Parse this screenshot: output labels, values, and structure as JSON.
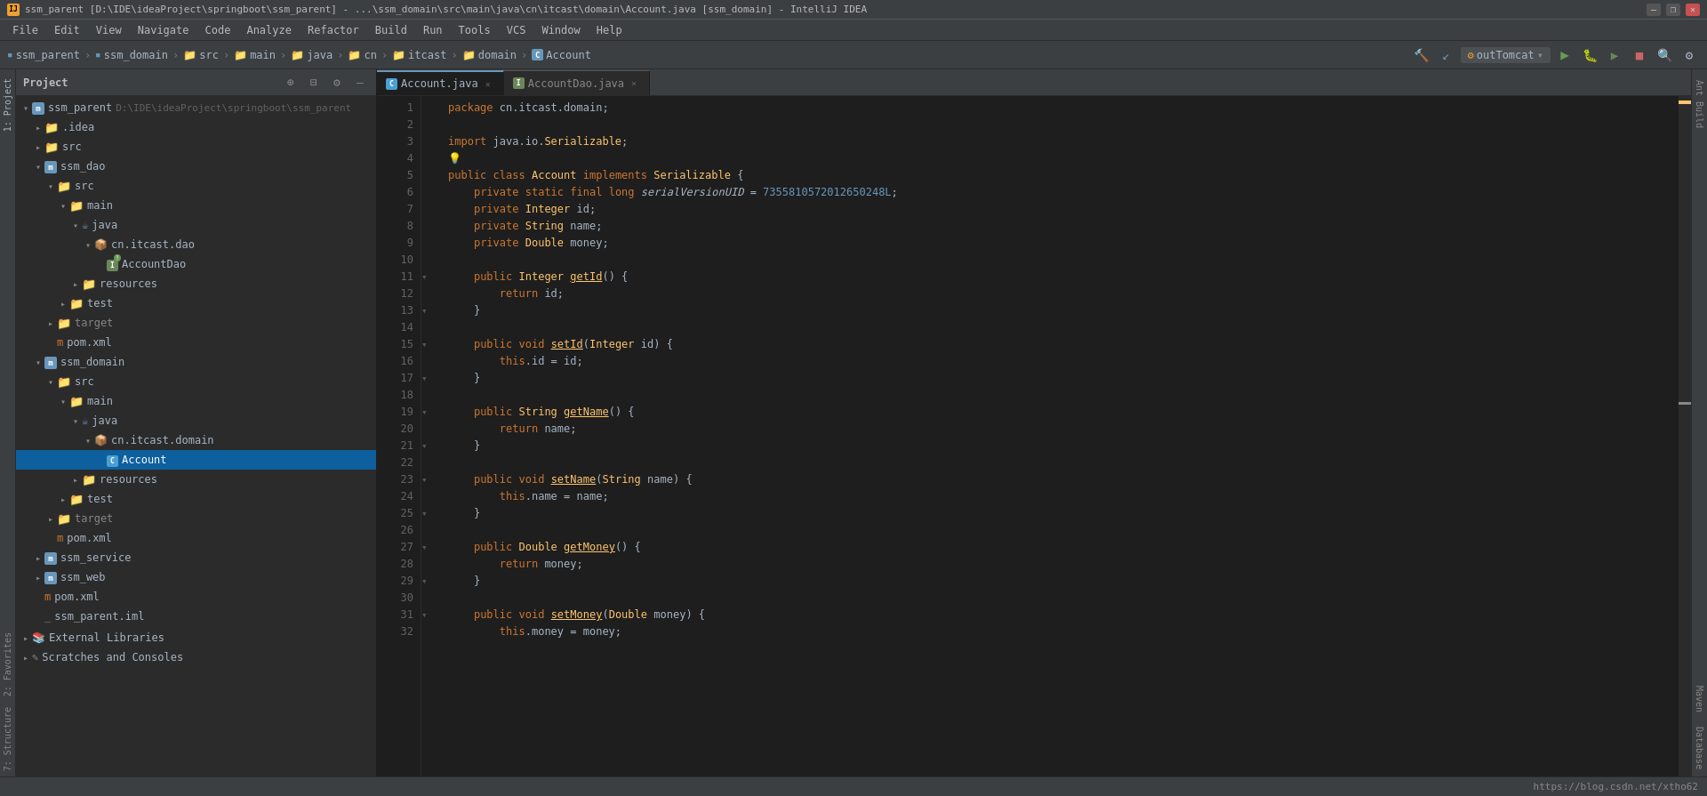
{
  "title_bar": {
    "icon": "IJ",
    "text": "ssm_parent [D:\\IDE\\ideaProject\\springboot\\ssm_parent] - ...\\ssm_domain\\src\\main\\java\\cn\\itcast\\domain\\Account.java [ssm_domain] - IntelliJ IDEA",
    "minimize": "—",
    "maximize": "❒",
    "close": "✕"
  },
  "menu": {
    "items": [
      "File",
      "Edit",
      "View",
      "Navigate",
      "Code",
      "Analyze",
      "Refactor",
      "Build",
      "Run",
      "Tools",
      "VCS",
      "Window",
      "Help"
    ]
  },
  "breadcrumb": {
    "items": [
      "ssm_parent",
      "ssm_domain",
      "src",
      "main",
      "java",
      "cn",
      "itcast",
      "domain",
      "Account"
    ],
    "run_config": "outTomcat"
  },
  "project_panel": {
    "title": "Project",
    "tree": [
      {
        "id": "ssm_parent",
        "indent": 0,
        "type": "module",
        "label": "ssm_parent",
        "path": "D:\\IDE\\ideaProject\\springboot\\ssm_parent",
        "arrow": "expanded"
      },
      {
        "id": "idea",
        "indent": 1,
        "type": "folder",
        "label": ".idea",
        "arrow": "collapsed"
      },
      {
        "id": "src_top",
        "indent": 1,
        "type": "folder",
        "label": "src",
        "arrow": "collapsed"
      },
      {
        "id": "ssm_dao",
        "indent": 1,
        "type": "module",
        "label": "ssm_dao",
        "arrow": "expanded"
      },
      {
        "id": "ssm_dao_src",
        "indent": 2,
        "type": "folder",
        "label": "src",
        "arrow": "expanded"
      },
      {
        "id": "ssm_dao_main",
        "indent": 3,
        "type": "folder",
        "label": "main",
        "arrow": "expanded"
      },
      {
        "id": "ssm_dao_java",
        "indent": 4,
        "type": "java",
        "label": "java",
        "arrow": "expanded"
      },
      {
        "id": "cn_itcast_dao",
        "indent": 5,
        "type": "package",
        "label": "cn.itcast.dao",
        "arrow": "expanded"
      },
      {
        "id": "AccountDao",
        "indent": 6,
        "type": "interface",
        "label": "AccountDao",
        "arrow": "empty"
      },
      {
        "id": "resources_dao",
        "indent": 4,
        "type": "folder",
        "label": "resources",
        "arrow": "collapsed"
      },
      {
        "id": "test_dao",
        "indent": 3,
        "type": "folder",
        "label": "test",
        "arrow": "collapsed"
      },
      {
        "id": "target_dao",
        "indent": 2,
        "type": "folder_target",
        "label": "target",
        "arrow": "collapsed"
      },
      {
        "id": "pom_dao",
        "indent": 2,
        "type": "xml",
        "label": "pom.xml",
        "arrow": "empty"
      },
      {
        "id": "ssm_domain",
        "indent": 1,
        "type": "module",
        "label": "ssm_domain",
        "arrow": "expanded"
      },
      {
        "id": "ssm_domain_src",
        "indent": 2,
        "type": "folder",
        "label": "src",
        "arrow": "expanded"
      },
      {
        "id": "ssm_domain_main",
        "indent": 3,
        "type": "folder",
        "label": "main",
        "arrow": "expanded"
      },
      {
        "id": "ssm_domain_java",
        "indent": 4,
        "type": "java",
        "label": "java",
        "arrow": "expanded"
      },
      {
        "id": "cn_itcast_domain",
        "indent": 5,
        "type": "package",
        "label": "cn.itcast.domain",
        "arrow": "expanded"
      },
      {
        "id": "Account",
        "indent": 6,
        "type": "class",
        "label": "Account",
        "arrow": "empty",
        "selected": true
      },
      {
        "id": "resources_domain",
        "indent": 4,
        "type": "folder",
        "label": "resources",
        "arrow": "collapsed"
      },
      {
        "id": "test_domain",
        "indent": 3,
        "type": "folder",
        "label": "test",
        "arrow": "collapsed"
      },
      {
        "id": "target_domain",
        "indent": 2,
        "type": "folder_target",
        "label": "target",
        "arrow": "collapsed"
      },
      {
        "id": "pom_domain",
        "indent": 2,
        "type": "xml",
        "label": "pom.xml",
        "arrow": "empty"
      },
      {
        "id": "ssm_service",
        "indent": 1,
        "type": "module",
        "label": "ssm_service",
        "arrow": "collapsed"
      },
      {
        "id": "ssm_web",
        "indent": 1,
        "type": "module",
        "label": "ssm_web",
        "arrow": "collapsed"
      },
      {
        "id": "pom_root",
        "indent": 1,
        "type": "xml",
        "label": "pom.xml",
        "arrow": "empty"
      },
      {
        "id": "ssm_parent_iml",
        "indent": 1,
        "type": "file",
        "label": "ssm_parent.iml",
        "arrow": "empty"
      },
      {
        "id": "external_libs",
        "indent": 0,
        "type": "libs",
        "label": "External Libraries",
        "arrow": "collapsed"
      },
      {
        "id": "scratches",
        "indent": 0,
        "type": "scratch",
        "label": "Scratches and Consoles",
        "arrow": "collapsed"
      }
    ]
  },
  "tabs": [
    {
      "id": "account_java",
      "label": "Account.java",
      "type": "class",
      "active": true
    },
    {
      "id": "account_dao_java",
      "label": "AccountDao.java",
      "type": "interface",
      "active": false
    }
  ],
  "code": {
    "lines": [
      {
        "num": 1,
        "content": "package cn.itcast.domain;",
        "tokens": [
          {
            "t": "kw",
            "v": "package"
          },
          {
            "t": "plain",
            "v": " cn.itcast.domain;"
          }
        ]
      },
      {
        "num": 2,
        "content": "",
        "tokens": []
      },
      {
        "num": 3,
        "content": "import java.io.Serializable;",
        "tokens": [
          {
            "t": "kw",
            "v": "import"
          },
          {
            "t": "plain",
            "v": " java.io.Serializable;"
          }
        ]
      },
      {
        "num": 4,
        "content": "💡",
        "tokens": [
          {
            "t": "bulb",
            "v": "💡"
          }
        ]
      },
      {
        "num": 5,
        "content": "public class Account implements Serializable {",
        "tokens": [
          {
            "t": "kw",
            "v": "public"
          },
          {
            "t": "plain",
            "v": " "
          },
          {
            "t": "kw",
            "v": "class"
          },
          {
            "t": "plain",
            "v": " "
          },
          {
            "t": "cls",
            "v": "Account"
          },
          {
            "t": "plain",
            "v": " "
          },
          {
            "t": "kw",
            "v": "implements"
          },
          {
            "t": "plain",
            "v": " "
          },
          {
            "t": "cls",
            "v": "Serializable"
          },
          {
            "t": "plain",
            "v": " {"
          }
        ]
      },
      {
        "num": 6,
        "content": "    private static final long serialVersionUID = 7355810572012650248L;",
        "tokens": [
          {
            "t": "plain",
            "v": "    "
          },
          {
            "t": "kw",
            "v": "private"
          },
          {
            "t": "plain",
            "v": " "
          },
          {
            "t": "kw",
            "v": "static"
          },
          {
            "t": "plain",
            "v": " "
          },
          {
            "t": "kw",
            "v": "final"
          },
          {
            "t": "plain",
            "v": " "
          },
          {
            "t": "kw",
            "v": "long"
          },
          {
            "t": "plain",
            "v": " "
          },
          {
            "t": "plain",
            "v": "serialVersionUID"
          },
          {
            "t": "plain",
            "v": " = "
          },
          {
            "t": "num",
            "v": "7355810572012650248L"
          },
          {
            "t": "plain",
            "v": ";"
          }
        ]
      },
      {
        "num": 7,
        "content": "    private Integer id;",
        "tokens": [
          {
            "t": "plain",
            "v": "    "
          },
          {
            "t": "kw",
            "v": "private"
          },
          {
            "t": "plain",
            "v": " "
          },
          {
            "t": "cls",
            "v": "Integer"
          },
          {
            "t": "plain",
            "v": " id;"
          }
        ]
      },
      {
        "num": 8,
        "content": "    private String name;",
        "tokens": [
          {
            "t": "plain",
            "v": "    "
          },
          {
            "t": "kw",
            "v": "private"
          },
          {
            "t": "plain",
            "v": " "
          },
          {
            "t": "cls",
            "v": "String"
          },
          {
            "t": "plain",
            "v": " name;"
          }
        ]
      },
      {
        "num": 9,
        "content": "    private Double money;",
        "tokens": [
          {
            "t": "plain",
            "v": "    "
          },
          {
            "t": "kw",
            "v": "private"
          },
          {
            "t": "plain",
            "v": " "
          },
          {
            "t": "cls",
            "v": "Double"
          },
          {
            "t": "plain",
            "v": " money;"
          }
        ]
      },
      {
        "num": 10,
        "content": "",
        "tokens": []
      },
      {
        "num": 11,
        "content": "    public Integer getId() {",
        "tokens": [
          {
            "t": "plain",
            "v": "    "
          },
          {
            "t": "kw",
            "v": "public"
          },
          {
            "t": "plain",
            "v": " "
          },
          {
            "t": "cls",
            "v": "Integer"
          },
          {
            "t": "plain",
            "v": " "
          },
          {
            "t": "fn-underline",
            "v": "getId"
          },
          {
            "t": "plain",
            "v": "() {"
          }
        ],
        "fold": true
      },
      {
        "num": 12,
        "content": "        return id;",
        "tokens": [
          {
            "t": "plain",
            "v": "        "
          },
          {
            "t": "kw",
            "v": "return"
          },
          {
            "t": "plain",
            "v": " id;"
          }
        ]
      },
      {
        "num": 13,
        "content": "    }",
        "tokens": [
          {
            "t": "plain",
            "v": "    }"
          }
        ],
        "fold": true
      },
      {
        "num": 14,
        "content": "",
        "tokens": []
      },
      {
        "num": 15,
        "content": "    public void setId(Integer id) {",
        "tokens": [
          {
            "t": "plain",
            "v": "    "
          },
          {
            "t": "kw",
            "v": "public"
          },
          {
            "t": "plain",
            "v": " "
          },
          {
            "t": "kw",
            "v": "void"
          },
          {
            "t": "plain",
            "v": " "
          },
          {
            "t": "fn-underline",
            "v": "setId"
          },
          {
            "t": "plain",
            "v": "("
          },
          {
            "t": "cls",
            "v": "Integer"
          },
          {
            "t": "plain",
            "v": " id) {"
          }
        ],
        "fold": true
      },
      {
        "num": 16,
        "content": "        this.id = id;",
        "tokens": [
          {
            "t": "plain",
            "v": "        "
          },
          {
            "t": "kw",
            "v": "this"
          },
          {
            "t": "plain",
            "v": ".id = id;"
          }
        ]
      },
      {
        "num": 17,
        "content": "    }",
        "tokens": [
          {
            "t": "plain",
            "v": "    }"
          }
        ],
        "fold": true
      },
      {
        "num": 18,
        "content": "",
        "tokens": []
      },
      {
        "num": 19,
        "content": "    public String getName() {",
        "tokens": [
          {
            "t": "plain",
            "v": "    "
          },
          {
            "t": "kw",
            "v": "public"
          },
          {
            "t": "plain",
            "v": " "
          },
          {
            "t": "cls",
            "v": "String"
          },
          {
            "t": "plain",
            "v": " "
          },
          {
            "t": "fn-underline",
            "v": "getName"
          },
          {
            "t": "plain",
            "v": "() {"
          }
        ],
        "fold": true
      },
      {
        "num": 20,
        "content": "        return name;",
        "tokens": [
          {
            "t": "plain",
            "v": "        "
          },
          {
            "t": "kw",
            "v": "return"
          },
          {
            "t": "plain",
            "v": " name;"
          }
        ]
      },
      {
        "num": 21,
        "content": "    }",
        "tokens": [
          {
            "t": "plain",
            "v": "    }"
          }
        ],
        "fold": true
      },
      {
        "num": 22,
        "content": "",
        "tokens": []
      },
      {
        "num": 23,
        "content": "    public void setName(String name) {",
        "tokens": [
          {
            "t": "plain",
            "v": "    "
          },
          {
            "t": "kw",
            "v": "public"
          },
          {
            "t": "plain",
            "v": " "
          },
          {
            "t": "kw",
            "v": "void"
          },
          {
            "t": "plain",
            "v": " "
          },
          {
            "t": "fn-underline",
            "v": "setName"
          },
          {
            "t": "plain",
            "v": "("
          },
          {
            "t": "cls",
            "v": "String"
          },
          {
            "t": "plain",
            "v": " name) {"
          }
        ],
        "fold": true
      },
      {
        "num": 24,
        "content": "        this.name = name;",
        "tokens": [
          {
            "t": "plain",
            "v": "        "
          },
          {
            "t": "kw",
            "v": "this"
          },
          {
            "t": "plain",
            "v": ".name = name;"
          }
        ]
      },
      {
        "num": 25,
        "content": "    }",
        "tokens": [
          {
            "t": "plain",
            "v": "    }"
          }
        ],
        "fold": true
      },
      {
        "num": 26,
        "content": "",
        "tokens": []
      },
      {
        "num": 27,
        "content": "    public Double getMoney() {",
        "tokens": [
          {
            "t": "plain",
            "v": "    "
          },
          {
            "t": "kw",
            "v": "public"
          },
          {
            "t": "plain",
            "v": " "
          },
          {
            "t": "cls",
            "v": "Double"
          },
          {
            "t": "plain",
            "v": " "
          },
          {
            "t": "fn-underline",
            "v": "getMoney"
          },
          {
            "t": "plain",
            "v": "() {"
          }
        ],
        "fold": true
      },
      {
        "num": 28,
        "content": "        return money;",
        "tokens": [
          {
            "t": "plain",
            "v": "        "
          },
          {
            "t": "kw",
            "v": "return"
          },
          {
            "t": "plain",
            "v": " money;"
          }
        ]
      },
      {
        "num": 29,
        "content": "    }",
        "tokens": [
          {
            "t": "plain",
            "v": "    }"
          }
        ],
        "fold": true
      },
      {
        "num": 30,
        "content": "",
        "tokens": []
      },
      {
        "num": 31,
        "content": "    public void setMoney(Double money) {",
        "tokens": [
          {
            "t": "plain",
            "v": "    "
          },
          {
            "t": "kw",
            "v": "public"
          },
          {
            "t": "plain",
            "v": " "
          },
          {
            "t": "kw",
            "v": "void"
          },
          {
            "t": "plain",
            "v": " "
          },
          {
            "t": "fn-underline",
            "v": "setMoney"
          },
          {
            "t": "plain",
            "v": "("
          },
          {
            "t": "cls",
            "v": "Double"
          },
          {
            "t": "plain",
            "v": " money) {"
          }
        ],
        "fold": true
      },
      {
        "num": 32,
        "content": "        this.money = money;",
        "tokens": [
          {
            "t": "plain",
            "v": "        "
          },
          {
            "t": "kw",
            "v": "this"
          },
          {
            "t": "plain",
            "v": ".money = money;"
          }
        ]
      }
    ]
  },
  "bottom_bar": {
    "url": "https://blog.csdn.net/xtho62"
  },
  "right_side_tabs": [
    "Ant Build",
    "Maven",
    "Database"
  ],
  "left_side_tabs": [
    "1: Project",
    "2: Favorites",
    "7: Structure"
  ]
}
